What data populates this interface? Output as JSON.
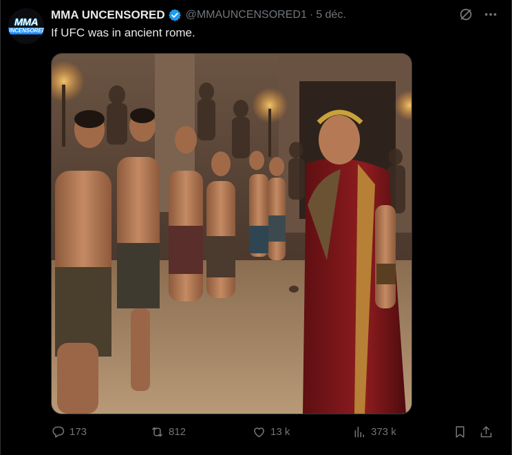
{
  "author": {
    "avatar_line1": "MMA",
    "avatar_line2": "UNCENSORED",
    "name": "MMA UNCENSORED",
    "handle": "@MMAUNCENSORED1",
    "separator": "·",
    "date": "5 déc."
  },
  "tweet": {
    "text": "If UFC was in ancient rome."
  },
  "actions": {
    "replies": "173",
    "reposts": "812",
    "likes": "13 k",
    "views": "373 k"
  },
  "icons": {
    "verified": "verified-badge-icon",
    "grok": "grok-icon",
    "more": "more-options-icon",
    "reply": "reply-icon",
    "repost": "repost-icon",
    "like": "heart-icon",
    "views": "views-icon",
    "bookmark": "bookmark-icon",
    "share": "share-icon"
  },
  "colors": {
    "background": "#000000",
    "text": "#e7e9ea",
    "muted": "#71767b",
    "verified": "#1d9bf0",
    "border": "#2f3336"
  }
}
